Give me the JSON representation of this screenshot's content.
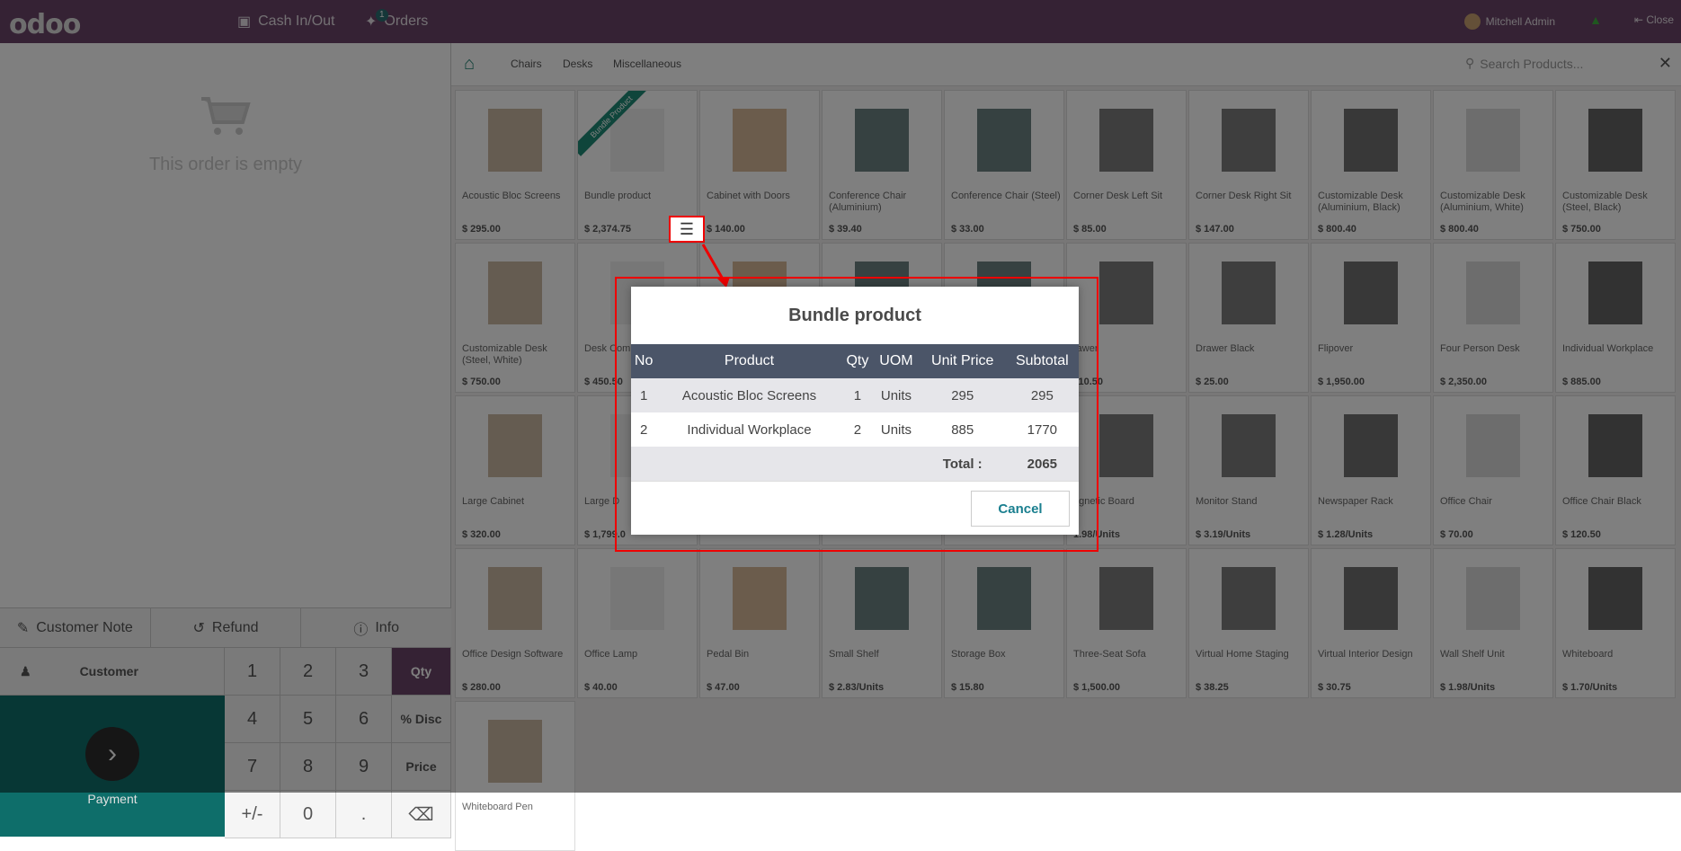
{
  "topbar": {
    "logo": "odoo",
    "cash_label": "Cash In/Out",
    "orders_label": "Orders",
    "orders_badge": "1",
    "user_name": "Mitchell Admin",
    "close_label": "Close"
  },
  "order": {
    "empty_text": "This order is empty"
  },
  "controls": {
    "customer_note": "Customer Note",
    "refund": "Refund",
    "info": "Info",
    "customer": "Customer",
    "payment": "Payment",
    "keys": [
      "1",
      "2",
      "3",
      "4",
      "5",
      "6",
      "7",
      "8",
      "9",
      "+/-",
      "0",
      "."
    ],
    "modes": [
      "Qty",
      "% Disc",
      "Price"
    ]
  },
  "categories": {
    "items": [
      "Chairs",
      "Desks",
      "Miscellaneous"
    ],
    "search_placeholder": "Search Products..."
  },
  "products": [
    {
      "name": "Acoustic Bloc Screens",
      "price": "$ 295.00"
    },
    {
      "name": "Bundle product",
      "price": "$ 2,374.75",
      "ribbon": "Bundle Product"
    },
    {
      "name": "Cabinet with Doors",
      "price": "$ 140.00"
    },
    {
      "name": "Conference Chair (Aluminium)",
      "price": "$ 39.40"
    },
    {
      "name": "Conference Chair (Steel)",
      "price": "$ 33.00"
    },
    {
      "name": "Corner Desk Left Sit",
      "price": "$ 85.00"
    },
    {
      "name": "Corner Desk Right Sit",
      "price": "$ 147.00"
    },
    {
      "name": "Customizable Desk (Aluminium, Black)",
      "price": "$ 800.40"
    },
    {
      "name": "Customizable Desk (Aluminium, White)",
      "price": "$ 800.40"
    },
    {
      "name": "Customizable Desk (Steel, Black)",
      "price": "$ 750.00"
    },
    {
      "name": "Customizable Desk (Steel, White)",
      "price": "$ 750.00"
    },
    {
      "name": "Desk Com",
      "price": "$ 450.50"
    },
    {
      "name": "",
      "price": ""
    },
    {
      "name": "",
      "price": ""
    },
    {
      "name": "",
      "price": ""
    },
    {
      "name": "rawer",
      "price": "110.50"
    },
    {
      "name": "Drawer Black",
      "price": "$ 25.00"
    },
    {
      "name": "Flipover",
      "price": "$ 1,950.00"
    },
    {
      "name": "Four Person Desk",
      "price": "$ 2,350.00"
    },
    {
      "name": "Individual Workplace",
      "price": "$ 885.00"
    },
    {
      "name": "Large Cabinet",
      "price": "$ 320.00"
    },
    {
      "name": "Large D",
      "price": "$ 1,799.0"
    },
    {
      "name": "",
      "price": ""
    },
    {
      "name": "",
      "price": ""
    },
    {
      "name": "",
      "price": ""
    },
    {
      "name": "agnetic Board",
      "price": "1.98/Units"
    },
    {
      "name": "Monitor Stand",
      "price": "$ 3.19/Units"
    },
    {
      "name": "Newspaper Rack",
      "price": "$ 1.28/Units"
    },
    {
      "name": "Office Chair",
      "price": "$ 70.00"
    },
    {
      "name": "Office Chair Black",
      "price": "$ 120.50"
    },
    {
      "name": "Office Design Software",
      "price": "$ 280.00"
    },
    {
      "name": "Office Lamp",
      "price": "$ 40.00"
    },
    {
      "name": "Pedal Bin",
      "price": "$ 47.00"
    },
    {
      "name": "Small Shelf",
      "price": "$ 2.83/Units"
    },
    {
      "name": "Storage Box",
      "price": "$ 15.80"
    },
    {
      "name": "Three-Seat Sofa",
      "price": "$ 1,500.00"
    },
    {
      "name": "Virtual Home Staging",
      "price": "$ 38.25"
    },
    {
      "name": "Virtual Interior Design",
      "price": "$ 30.75"
    },
    {
      "name": "Wall Shelf Unit",
      "price": "$ 1.98/Units"
    },
    {
      "name": "Whiteboard",
      "price": "$ 1.70/Units"
    },
    {
      "name": "Whiteboard Pen",
      "price": ""
    }
  ],
  "dialog": {
    "title": "Bundle product",
    "headers": [
      "No",
      "Product",
      "Qty",
      "UOM",
      "Unit Price",
      "Subtotal"
    ],
    "rows": [
      [
        "1",
        "Acoustic Bloc Screens",
        "1",
        "Units",
        "295",
        "295"
      ],
      [
        "2",
        "Individual Workplace",
        "2",
        "Units",
        "885",
        "1770"
      ]
    ],
    "total_label": "Total :",
    "total_value": "2065",
    "cancel_label": "Cancel"
  }
}
